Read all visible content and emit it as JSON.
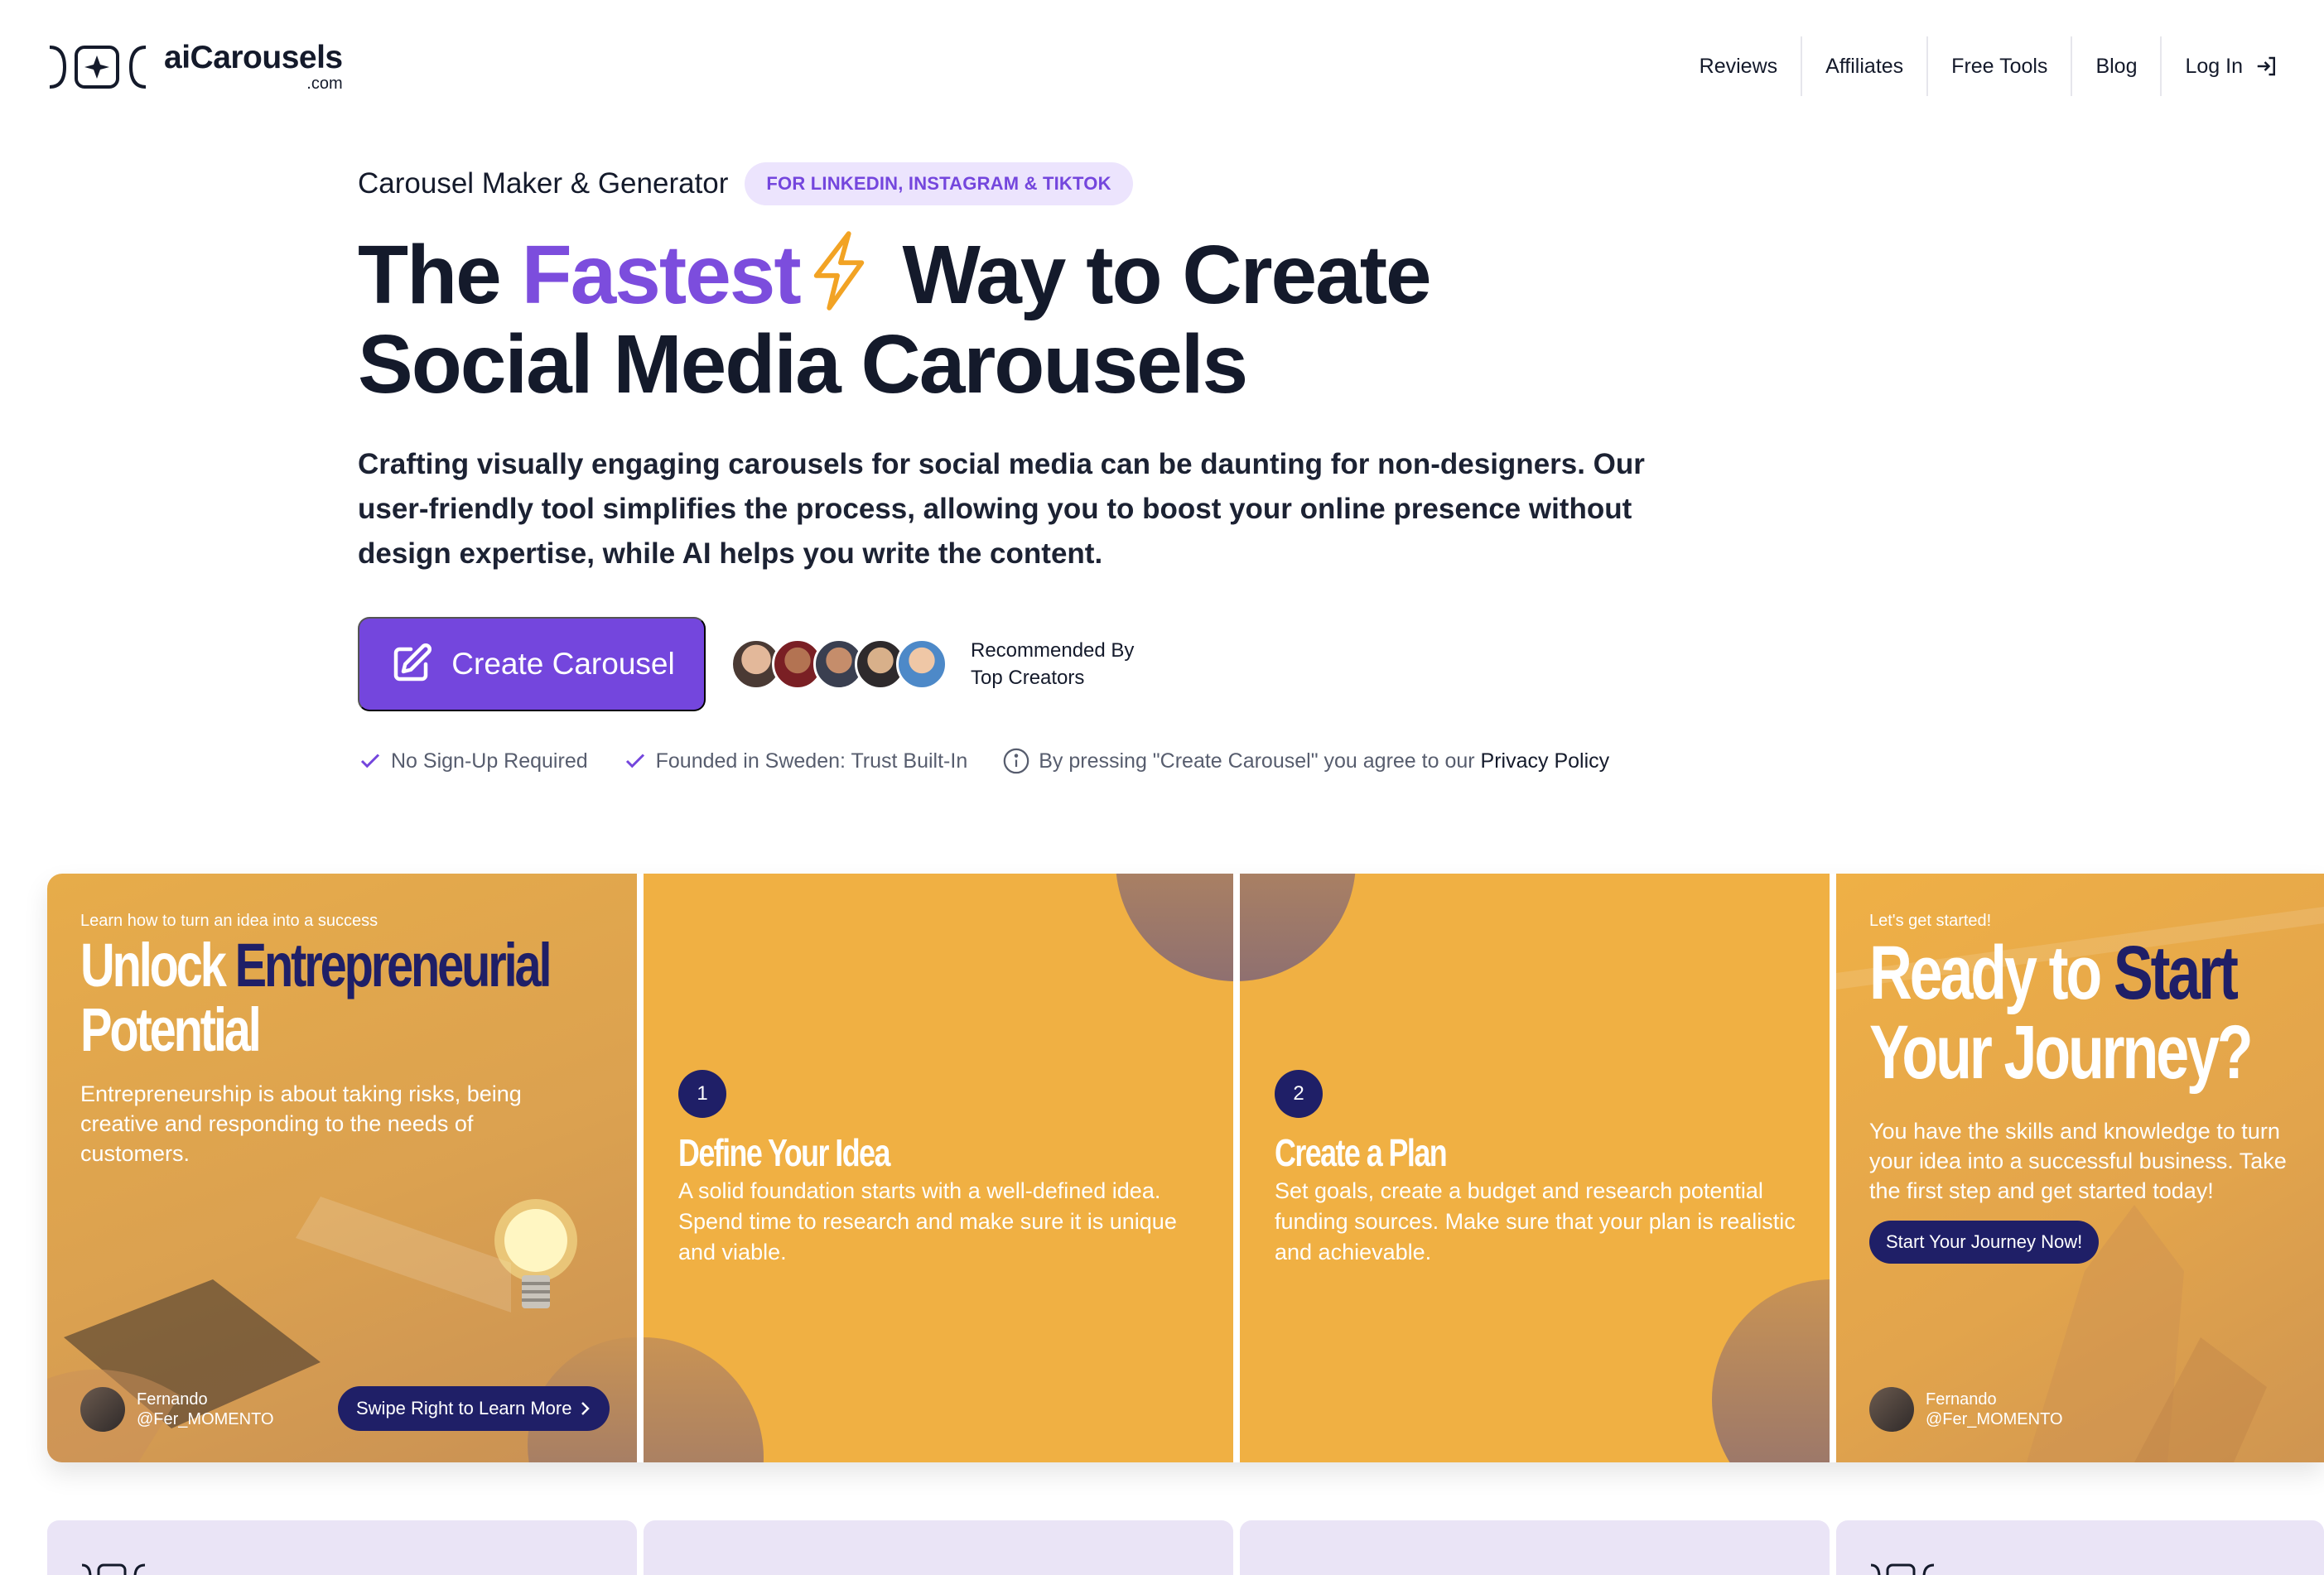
{
  "brand": {
    "name": "aiCarousels",
    "tld": ".com"
  },
  "nav": {
    "items": [
      "Reviews",
      "Affiliates",
      "Free Tools",
      "Blog"
    ],
    "login": "Log In"
  },
  "hero": {
    "eyebrow": "Carousel Maker & Generator",
    "pill": "FOR LINKEDIN, INSTAGRAM & TIKTOK",
    "headline_pre": "The ",
    "headline_accent": "Fastest",
    "headline_post": " Way to Create",
    "headline_line2": "Social Media Carousels",
    "subtext": "Crafting visually engaging carousels for social media can be daunting for non-designers. Our user-friendly tool simplifies the process, allowing you to boost your online presence without design expertise, while AI helps you write the content.",
    "cta": "Create Carousel",
    "recommended_line1": "Recommended By",
    "recommended_line2": "Top Creators",
    "trust": [
      "No Sign-Up Required",
      "Founded in Sweden: Trust Built-In"
    ],
    "privacy_pre": "By pressing \"Create Carousel\" you agree to our ",
    "privacy_link": "Privacy Policy"
  },
  "carousel": {
    "slide1": {
      "kicker": "Learn how to turn an idea into a success",
      "title_white": "Unlock ",
      "title_navy": "Entrepreneurial",
      "title_line2": "Potential",
      "body": "Entrepreneurship is about taking risks, being creative and responding to the needs of customers.",
      "swipe": "Swipe Right to Learn More",
      "author_name": "Fernando",
      "author_handle": "@Fer_MOMENTO"
    },
    "slide2": {
      "number": "1",
      "title": "Define Your Idea",
      "body": "A solid foundation starts with a well-defined idea. Spend time to research and make sure it is unique and viable."
    },
    "slide3": {
      "number": "2",
      "title": "Create a Plan",
      "body": "Set goals, create a budget and research potential funding sources. Make sure that your plan is realistic and achievable."
    },
    "slide4": {
      "kicker": "Let's get started!",
      "title_white": "Ready to ",
      "title_navy": "Start",
      "title_line2": "Your Journey?",
      "body": "You have the skills and knowledge to turn your idea into a successful business. Take the first step and get started today!",
      "button": "Start Your Journey Now!",
      "author_name": "Fernando",
      "author_handle": "@Fer_MOMENTO"
    }
  },
  "colors": {
    "accent": "#7446dd",
    "navy": "#1f1f67",
    "slide_orange": "#f0b043",
    "pill_bg": "#ece4fd"
  }
}
